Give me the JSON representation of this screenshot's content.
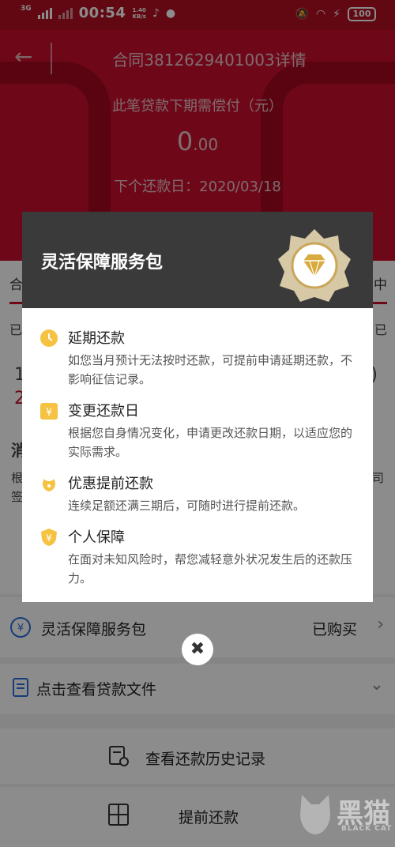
{
  "status_bar": {
    "network": "3G",
    "time": "00:54",
    "speed_value": "1.40",
    "speed_unit": "KB/s",
    "battery": "100"
  },
  "header": {
    "title": "合同3812629401003详情",
    "due_label": "此笔贷款下期需偿付（元）",
    "due_amount_int": "0",
    "due_amount_dec": ".00",
    "next_due_date": "下个还款日：2020/03/18"
  },
  "background": {
    "tab_left": "合",
    "tab_right": "中",
    "peek_1": "已",
    "peek_2": "已",
    "peek_3": "1",
    "peek_4": "2",
    "peek_5": ")",
    "peek_6": "消",
    "peek_7": "根",
    "peek_8": "司",
    "peek_9": "签",
    "service_row": {
      "label": "灵活保障服务包",
      "status": "已购买",
      "chevron": "›"
    },
    "docs_row": {
      "label": "点击查看贷款文件",
      "chevron": "⌄"
    },
    "history_button": "查看还款历史记录",
    "prepay_button": "提前还款"
  },
  "modal": {
    "title": "灵活保障服务包",
    "features": [
      {
        "title": "延期还款",
        "desc": "如您当月预计无法按时还款，可提前申请延期还款，不影响征信记录。",
        "icon": "clock-icon"
      },
      {
        "title": "变更还款日",
        "desc": "根据您自身情况变化，申请更改还款日期，以适应您的实际需求。",
        "icon": "calendar-yen-icon"
      },
      {
        "title": "优惠提前还款",
        "desc": "连续足额还满三期后，可随时进行提前还款。",
        "icon": "discount-icon"
      },
      {
        "title": "个人保障",
        "desc": "在面对未知风险时，帮您减轻意外状况发生后的还款压力。",
        "icon": "shield-yen-icon"
      }
    ],
    "close_glyph": "✖"
  },
  "watermark": {
    "text": "黑猫",
    "sub": "BLACK CAT"
  },
  "colors": {
    "brand_red": "#c8102e",
    "modal_header": "#3a3a3a",
    "icon_gold": "#f5c242"
  }
}
